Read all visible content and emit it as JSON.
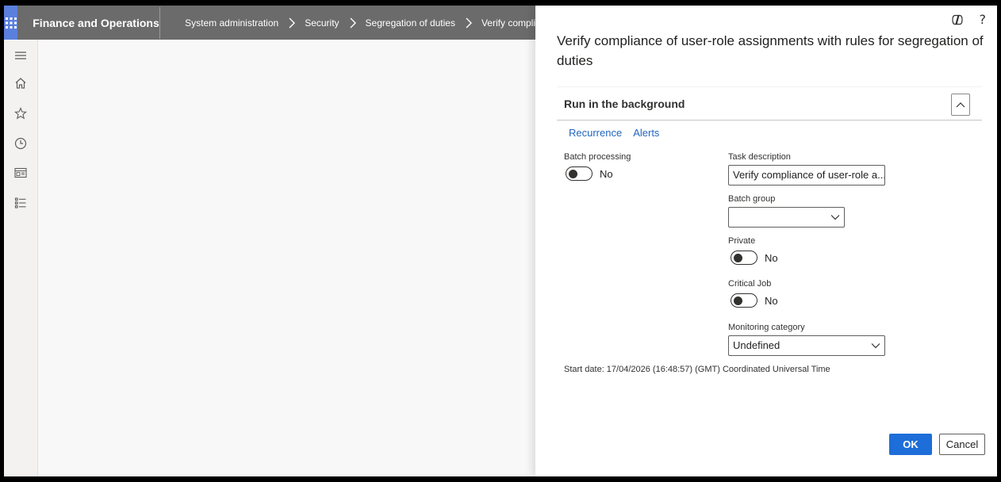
{
  "app": {
    "title": "Finance and Operations"
  },
  "breadcrumb": [
    "System administration",
    "Security",
    "Segregation of duties",
    "Verify compli"
  ],
  "nav": {
    "icons": [
      "hamburger-menu-icon",
      "home-icon",
      "star-icon",
      "clock-icon",
      "workspaces-icon",
      "modules-list-icon"
    ]
  },
  "dialog": {
    "title": "Verify compliance of user-role assignments with rules for segregation of duties",
    "section_title": "Run in the background",
    "links": {
      "recurrence": "Recurrence",
      "alerts": "Alerts"
    },
    "batch_processing": {
      "label": "Batch processing",
      "value": "No"
    },
    "task_description": {
      "label": "Task description",
      "value": "Verify compliance of user-role a..."
    },
    "batch_group": {
      "label": "Batch group",
      "value": ""
    },
    "private": {
      "label": "Private",
      "value": "No"
    },
    "critical_job": {
      "label": "Critical Job",
      "value": "No"
    },
    "monitoring_category": {
      "label": "Monitoring category",
      "value": "Undefined"
    },
    "start_date": "Start date: 17/04/2026 (16:48:57) (GMT) Coordinated Universal Time",
    "ok_label": "OK",
    "cancel_label": "Cancel",
    "help_glyph": "?"
  },
  "colors": {
    "topbar": "#6b6b6b",
    "waffle": "#5b7fdc",
    "link": "#2266c0",
    "primary_button": "#1d6ed8"
  }
}
